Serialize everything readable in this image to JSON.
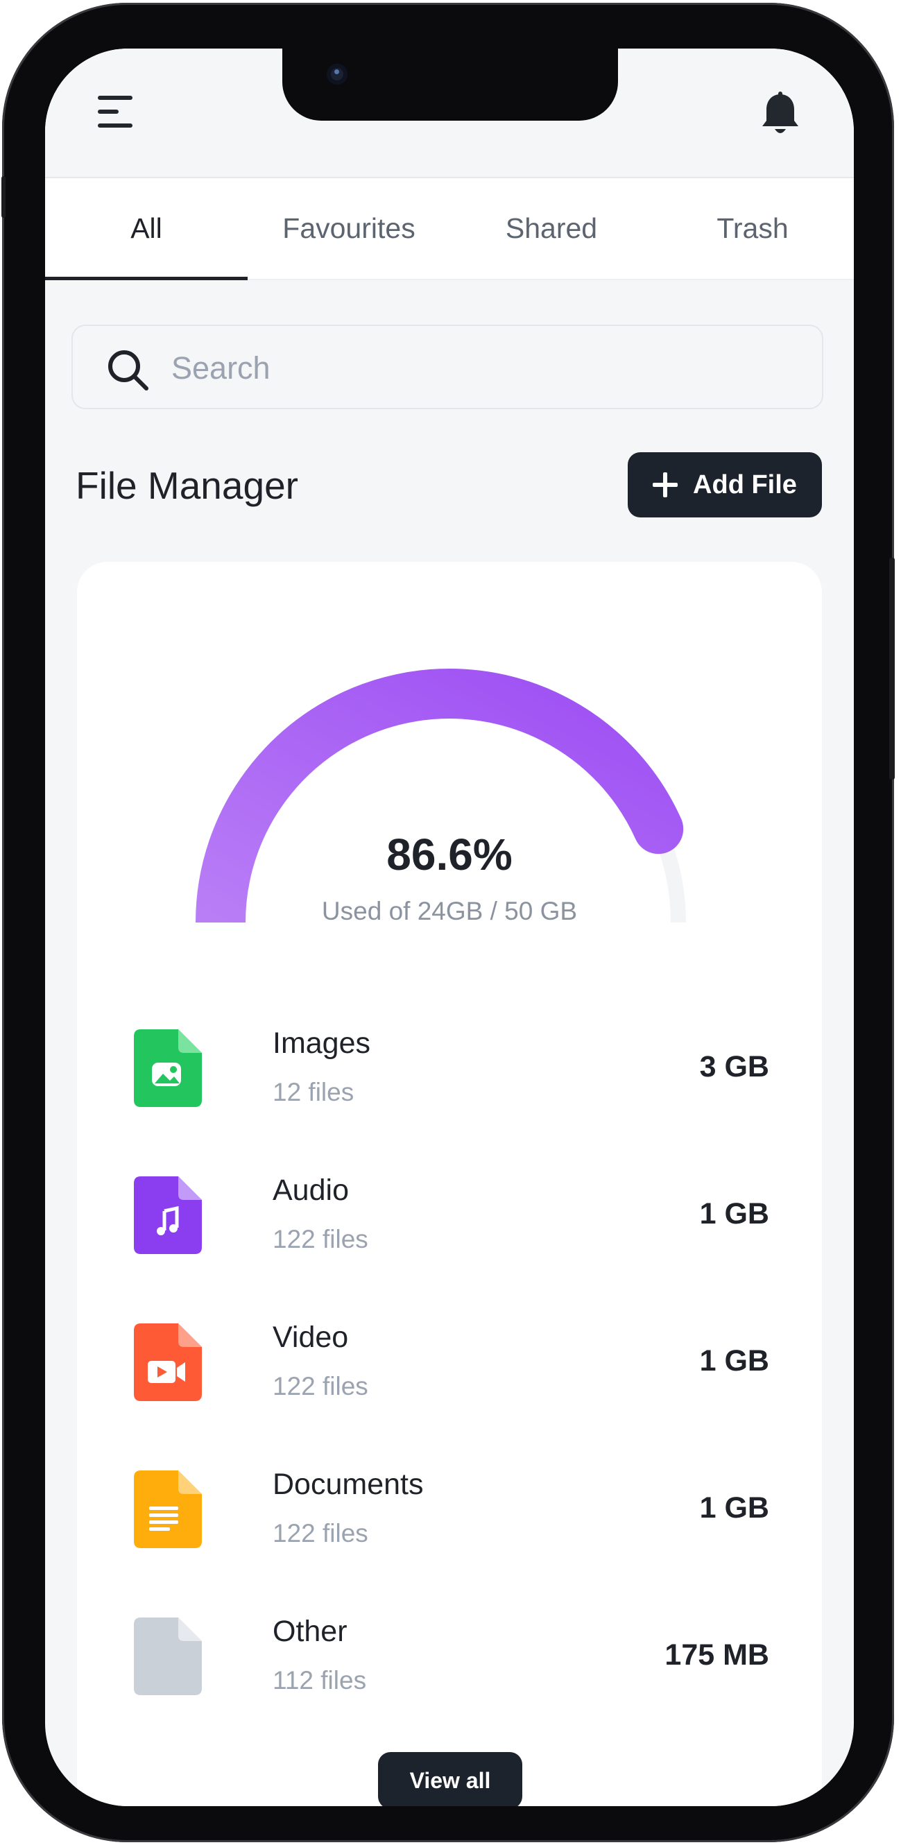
{
  "tabs": [
    "All",
    "Favourites",
    "Shared",
    "Trash"
  ],
  "active_tab": "All",
  "search": {
    "placeholder": "Search",
    "value": ""
  },
  "page_title": "File Manager",
  "add_button": "Add File",
  "storage": {
    "percent_label": "86.6%",
    "used_label": "Used of 24GB / 50 GB",
    "percent": 0.866,
    "fill_color": "#a95df5",
    "track_color": "#f3f4f6"
  },
  "files": [
    {
      "name": "Images",
      "count": "12 files",
      "size": "3 GB",
      "icon": "image-file-icon",
      "color": "#22c55e"
    },
    {
      "name": "Audio",
      "count": "122 files",
      "size": "1 GB",
      "icon": "audio-file-icon",
      "color": "#8b3df0"
    },
    {
      "name": "Video",
      "count": "122 files",
      "size": "1 GB",
      "icon": "video-file-icon",
      "color": "#ff5a36"
    },
    {
      "name": "Documents",
      "count": "122 files",
      "size": "1 GB",
      "icon": "document-file-icon",
      "color": "#ffad0d"
    },
    {
      "name": "Other",
      "count": "112 files",
      "size": "175 MB",
      "icon": "other-file-icon",
      "color": "#c9d0d8"
    }
  ],
  "view_all": "View all"
}
